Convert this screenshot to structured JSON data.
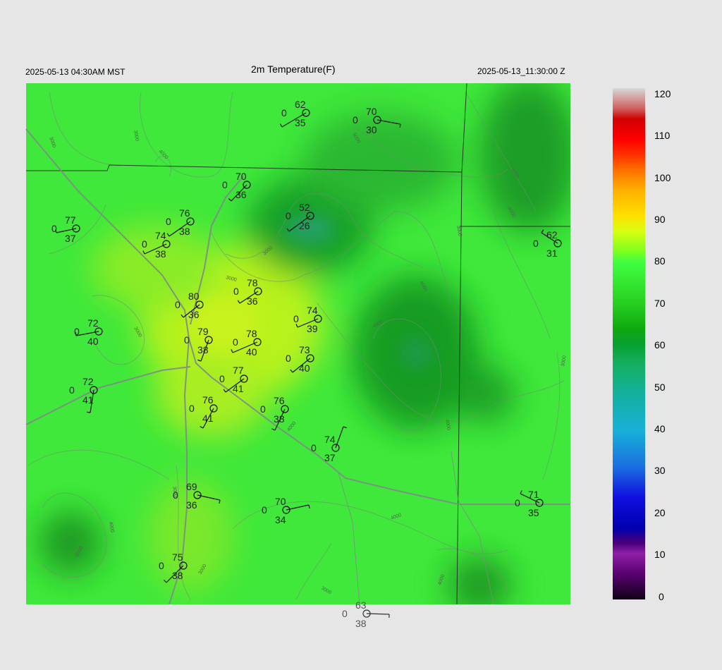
{
  "header": {
    "left_time": "2025-05-13 04:30AM MST",
    "title": "2m Temperature(F)",
    "right_time": "2025-05-13_11:30:00 Z"
  },
  "colorbar": {
    "labels": [
      "120",
      "110",
      "100",
      "90",
      "80",
      "70",
      "60",
      "50",
      "40",
      "30",
      "20",
      "10",
      "0"
    ]
  },
  "contour_labels": [
    "3000",
    "3000",
    "4000",
    "4000",
    "3000",
    "3000",
    "4000",
    "4000",
    "3000",
    "3000",
    "4000",
    "3000",
    "4000",
    "4000",
    "3000",
    "4000",
    "3000",
    "5000",
    "4000",
    "3000",
    "3000",
    "4000"
  ],
  "stations": [
    {
      "temp": "62",
      "zero": "0",
      "dew": "35"
    },
    {
      "temp": "70",
      "zero": "0",
      "dew": "30"
    },
    {
      "temp": "70",
      "zero": "0",
      "dew": "36"
    },
    {
      "temp": "52",
      "zero": "0",
      "dew": "26"
    },
    {
      "temp": "77",
      "zero": "0",
      "dew": "37"
    },
    {
      "temp": "76",
      "zero": "0",
      "dew": "38"
    },
    {
      "temp": "74",
      "zero": "0",
      "dew": "38"
    },
    {
      "temp": "62",
      "zero": "0",
      "dew": "31"
    },
    {
      "temp": "78",
      "zero": "0",
      "dew": "36"
    },
    {
      "temp": "80",
      "zero": "0",
      "dew": "36"
    },
    {
      "temp": "74",
      "zero": "0",
      "dew": "39"
    },
    {
      "temp": "72",
      "zero": "0",
      "dew": "40"
    },
    {
      "temp": "79",
      "zero": "0",
      "dew": "38"
    },
    {
      "temp": "78",
      "zero": "0",
      "dew": "40"
    },
    {
      "temp": "73",
      "zero": "0",
      "dew": "40"
    },
    {
      "temp": "77",
      "zero": "0",
      "dew": "41"
    },
    {
      "temp": "72",
      "zero": "0",
      "dew": "41"
    },
    {
      "temp": "76",
      "zero": "0",
      "dew": "41"
    },
    {
      "temp": "76",
      "zero": "0",
      "dew": "38"
    },
    {
      "temp": "74",
      "zero": "0",
      "dew": "37"
    },
    {
      "temp": "69",
      "zero": "0",
      "dew": "36"
    },
    {
      "temp": "70",
      "zero": "0",
      "dew": "34"
    },
    {
      "temp": "71",
      "zero": "0",
      "dew": "35"
    },
    {
      "temp": "75",
      "zero": "0",
      "dew": "38"
    },
    {
      "temp": "63",
      "zero": "0",
      "dew": "38"
    }
  ]
}
